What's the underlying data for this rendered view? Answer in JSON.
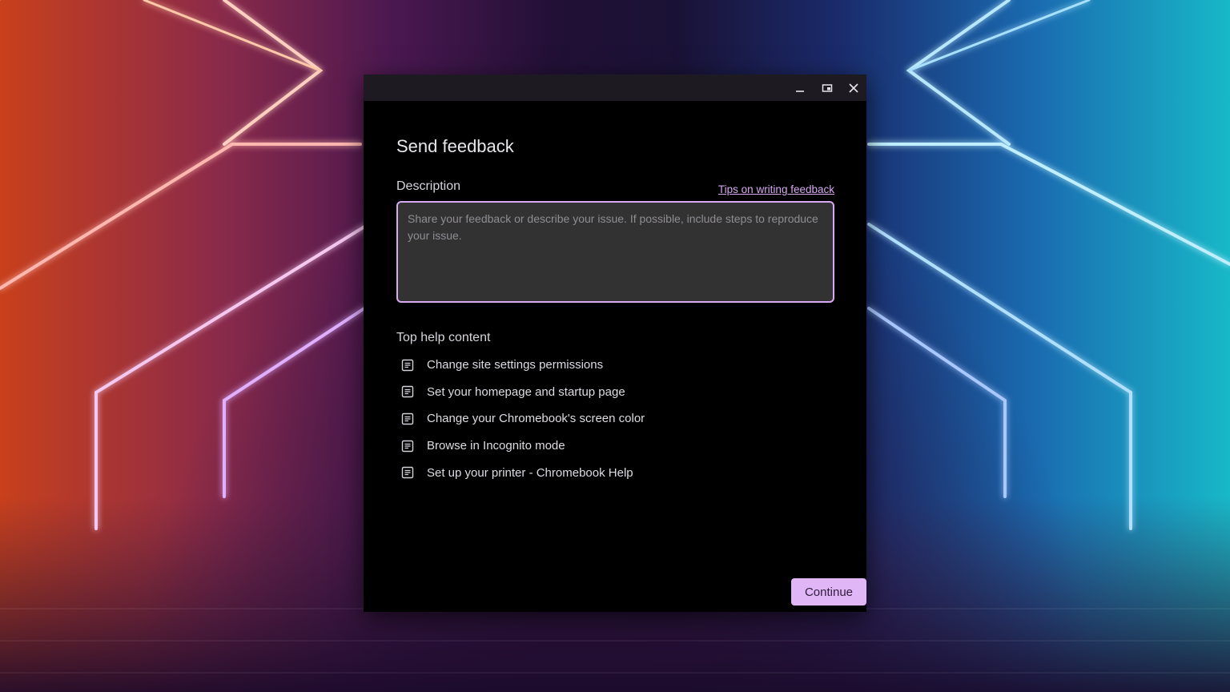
{
  "window": {
    "title": "Send feedback",
    "controls": {
      "minimize_icon": "minimize-icon",
      "maximize_icon": "restore-icon",
      "close_icon": "close-icon"
    }
  },
  "description": {
    "label": "Description",
    "tips_link": "Tips on writing feedback",
    "value": "",
    "placeholder": "Share your feedback or describe your issue. If possible, include steps to reproduce your issue."
  },
  "help": {
    "heading": "Top help content",
    "icon": "article-icon",
    "items": [
      {
        "label": "Change site settings permissions"
      },
      {
        "label": "Set your homepage and startup page"
      },
      {
        "label": "Change your Chromebook's screen color"
      },
      {
        "label": "Browse in Incognito mode"
      },
      {
        "label": "Set up your printer - Chromebook Help"
      }
    ]
  },
  "actions": {
    "continue_label": "Continue"
  },
  "colors": {
    "accent": "#e1b6f7",
    "link": "#d7a8f0",
    "window_bg": "#000000",
    "titlebar_bg": "#1d1a22",
    "field_bg": "#333233"
  }
}
